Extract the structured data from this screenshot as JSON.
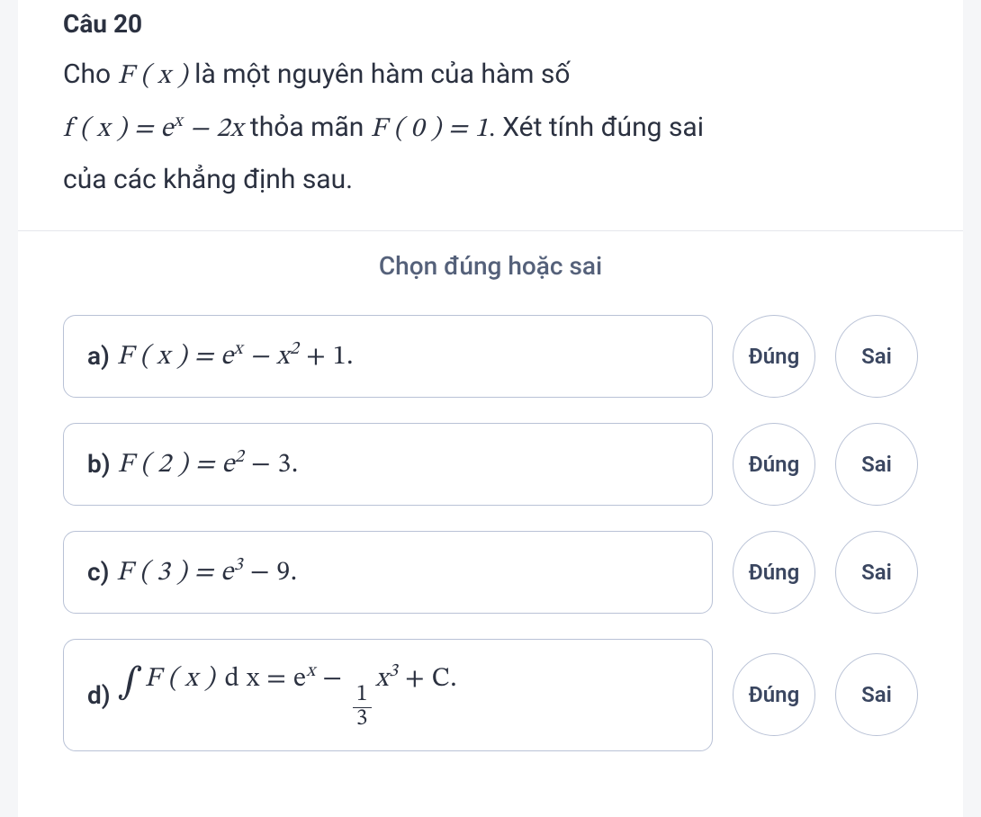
{
  "question_number": "Câu 20",
  "prompt_line1_pre": "Cho ",
  "prompt_line1_func": "F ( x )",
  "prompt_line1_post": " là một nguyên hàm của hàm số",
  "prompt_line2_fx_eq": "f ( x ) = e",
  "prompt_line2_exp": "x",
  "prompt_line2_minus2x": " − 2x",
  "prompt_line2_mid": " thỏa mãn ",
  "prompt_line2_F0": "F ( 0 ) = 1",
  "prompt_line2_tail": ". Xét tính đúng sai",
  "prompt_line3": "của các khẳng định sau.",
  "instruction": "Chọn đúng hoặc sai",
  "true_label": "Đúng",
  "false_label": "Sai",
  "opt_a_label": "a)",
  "opt_a_pre": "F ( x ) = e",
  "opt_a_exp": "x",
  "opt_a_post": " − x",
  "opt_a_sq": "2",
  "opt_a_tail": " + 1.",
  "opt_b_label": "b)",
  "opt_b_pre": "F ( 2 ) = e",
  "opt_b_exp": "2",
  "opt_b_tail": " − 3.",
  "opt_c_label": "c)",
  "opt_c_pre": "F ( 3 ) = e",
  "opt_c_exp": "3",
  "opt_c_tail": " − 9.",
  "opt_d_label": "d)",
  "opt_d_int": "∫",
  "opt_d_Fx": "F ( x )",
  "opt_d_dx_eq_e": "d x = e",
  "opt_d_exp": "x",
  "opt_d_minus": " − ",
  "opt_d_frac_num": "1",
  "opt_d_frac_den": "3",
  "opt_d_x": "x",
  "opt_d_cube": "3",
  "opt_d_tail": " + C."
}
